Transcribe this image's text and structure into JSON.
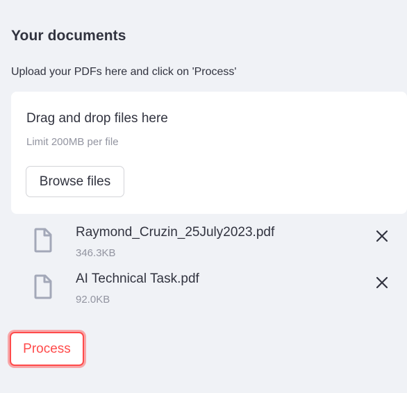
{
  "section": {
    "title": "Your documents",
    "instruction": "Upload your PDFs here and click on 'Process'"
  },
  "uploader": {
    "dropzone_title": "Drag and drop files here",
    "limit_text": "Limit 200MB per file",
    "browse_label": "Browse files"
  },
  "files": [
    {
      "name": "Raymond_Cruzin_25July2023.pdf",
      "size": "346.3KB",
      "icon": "file-icon"
    },
    {
      "name": "AI Technical Task.pdf",
      "size": "92.0KB",
      "icon": "file-icon"
    }
  ],
  "actions": {
    "process_label": "Process"
  },
  "colors": {
    "background": "#f0f2f6",
    "accent": "#ff4b4b",
    "text": "#31333f",
    "muted_text": "#9294a0",
    "icon": "#a3a8b8"
  }
}
